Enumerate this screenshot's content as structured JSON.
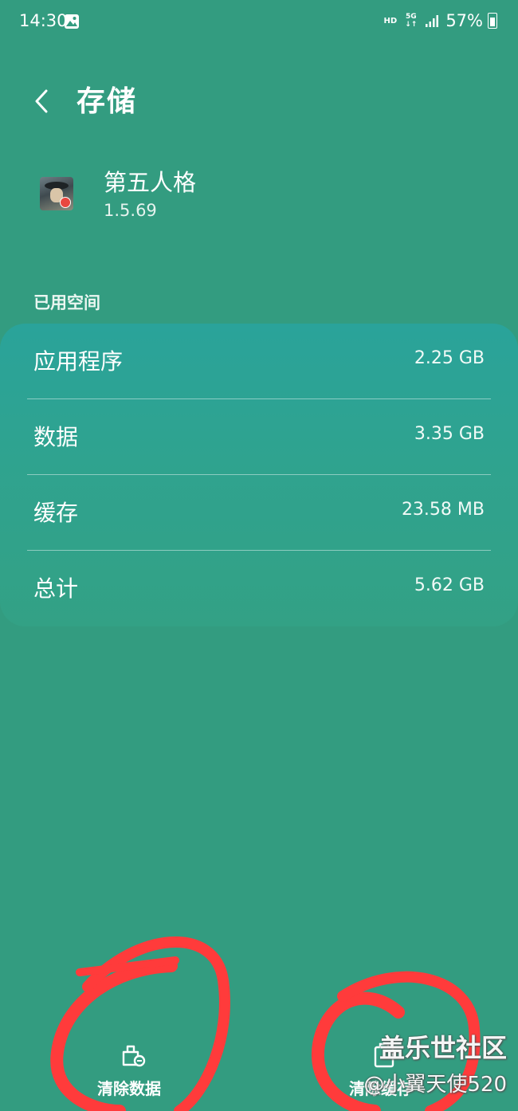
{
  "status_bar": {
    "time": "14:30",
    "network_hd": "HD",
    "network_5g": "5G",
    "battery": "57%"
  },
  "header": {
    "back_icon": "chevron-left-icon",
    "title": "存储"
  },
  "app": {
    "name": "第五人格",
    "version": "1.5.69"
  },
  "storage": {
    "section_label": "已用空间",
    "rows": [
      {
        "label": "应用程序",
        "value": "2.25 GB"
      },
      {
        "label": "数据",
        "value": "3.35 GB"
      },
      {
        "label": "缓存",
        "value": "23.58 MB"
      },
      {
        "label": "总计",
        "value": "5.62 GB"
      }
    ]
  },
  "actions": {
    "clear_data": "清除数据",
    "clear_cache": "清除缓存"
  },
  "watermark": {
    "line1": "盖乐世社区",
    "line2": "@小翼天使520"
  },
  "colors": {
    "background": "#339c80",
    "card": "#2aa39a",
    "annotation": "#ff3b3b"
  }
}
